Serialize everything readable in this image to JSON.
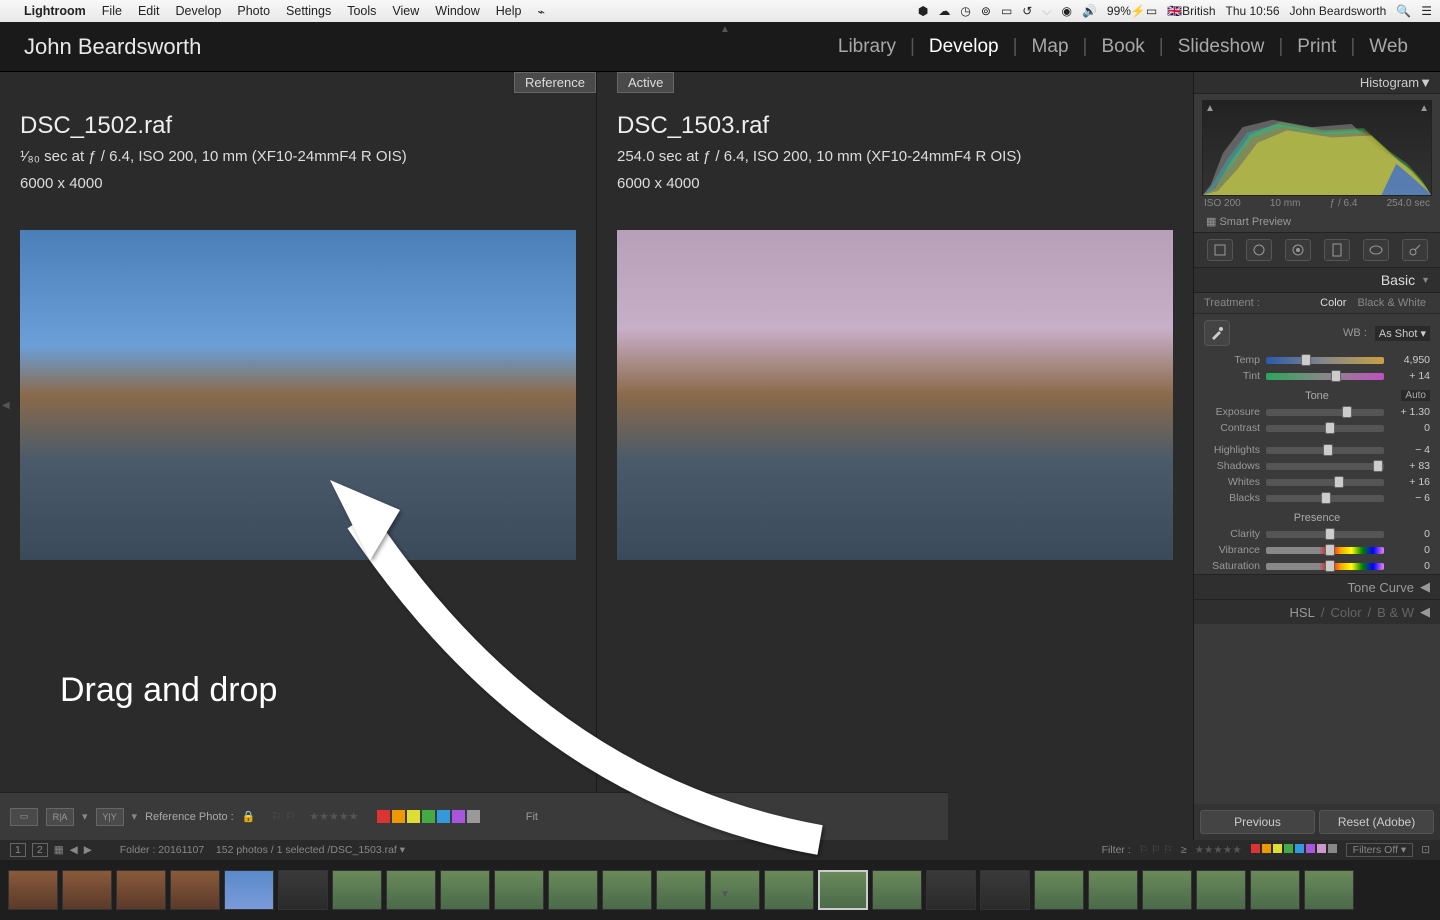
{
  "menubar": {
    "apple": "",
    "app": "Lightroom",
    "items": [
      "File",
      "Edit",
      "Develop",
      "Photo",
      "Settings",
      "Tools",
      "View",
      "Window",
      "Help"
    ],
    "status": {
      "battery": "99%",
      "lang": "British",
      "clock": "Thu 10:56",
      "user": "John Beardsworth"
    }
  },
  "header": {
    "identity": "John Beardsworth",
    "modules": [
      "Library",
      "Develop",
      "Map",
      "Book",
      "Slideshow",
      "Print",
      "Web"
    ],
    "active": "Develop"
  },
  "viewer": {
    "reference": {
      "label": "Reference",
      "filename": "DSC_1502.raf",
      "meta1": "¹⁄₈₀ sec at ƒ / 6.4, ISO 200, 10 mm (XF10-24mmF4 R OIS)",
      "meta2": "6000 x 4000"
    },
    "active": {
      "label": "Active",
      "filename": "DSC_1503.raf",
      "meta1": "254.0 sec at ƒ / 6.4, ISO 200, 10 mm (XF10-24mmF4 R OIS)",
      "meta2": "6000 x 4000"
    },
    "annotation": "Drag and drop"
  },
  "right": {
    "histogram_label": "Histogram",
    "histo_info": [
      "ISO 200",
      "10 mm",
      "ƒ / 6.4",
      "254.0 sec"
    ],
    "smart_preview": "Smart Preview",
    "basic_label": "Basic",
    "treatment": {
      "label": "Treatment :",
      "color": "Color",
      "bw": "Black & White"
    },
    "wb": {
      "label": "WB :",
      "value": "As Shot"
    },
    "sliders": {
      "temp": {
        "label": "Temp",
        "value": "4,950",
        "pos": 30
      },
      "tint": {
        "label": "Tint",
        "value": "+ 14",
        "pos": 55
      },
      "tone_title": "Tone",
      "auto": "Auto",
      "exposure": {
        "label": "Exposure",
        "value": "+ 1.30",
        "pos": 64
      },
      "contrast": {
        "label": "Contrast",
        "value": "0",
        "pos": 50
      },
      "highlights": {
        "label": "Highlights",
        "value": "− 4",
        "pos": 48
      },
      "shadows": {
        "label": "Shadows",
        "value": "+ 83",
        "pos": 91
      },
      "whites": {
        "label": "Whites",
        "value": "+ 16",
        "pos": 58
      },
      "blacks": {
        "label": "Blacks",
        "value": "− 6",
        "pos": 47
      },
      "presence_title": "Presence",
      "clarity": {
        "label": "Clarity",
        "value": "0",
        "pos": 50
      },
      "vibrance": {
        "label": "Vibrance",
        "value": "0",
        "pos": 50
      },
      "saturation": {
        "label": "Saturation",
        "value": "0",
        "pos": 50
      }
    },
    "tone_curve": "Tone Curve",
    "hsl": {
      "hsl": "HSL",
      "color": "Color",
      "bw": "B & W"
    },
    "previous": "Previous",
    "reset": "Reset (Adobe)"
  },
  "toolbar": {
    "ref_photo": "Reference Photo :",
    "ra": "R|A",
    "yy": "Y|Y",
    "fit": "Fit",
    "colors": [
      "#d33",
      "#e90",
      "#dd3",
      "#4a4",
      "#39d",
      "#a5d",
      "#999"
    ]
  },
  "filterbar": {
    "nums": [
      "1",
      "2"
    ],
    "folder_text": "Folder : 20161107",
    "count_text": "152 photos / 1 selected /",
    "current_file": "DSC_1503.raf",
    "filter_label": "Filter :",
    "filters_off": "Filters Off",
    "swatch_colors": [
      "#d33",
      "#e90",
      "#dd3",
      "#4a4",
      "#39d",
      "#a5d",
      "#c9c",
      "#888"
    ]
  }
}
